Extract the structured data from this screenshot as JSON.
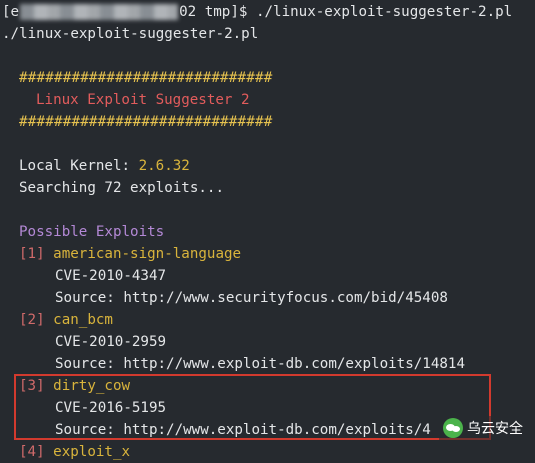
{
  "terminal": {
    "prompt_prefix": "[e",
    "prompt_suffix": "02 tmp]$ ./linux-exploit-suggester-2.pl",
    "echo_command": "./linux-exploit-suggester-2.pl",
    "banner_hash": "#############################",
    "banner_title": "Linux Exploit Suggester 2",
    "kernel_label": "Local Kernel: ",
    "kernel_version": "2.6.32",
    "searching": "Searching 72 exploits...",
    "possible_exploits": "Possible Exploits",
    "exploits": [
      {
        "num": "[1]",
        "name": "american-sign-language",
        "cve": "CVE-2010-4347",
        "source": "Source: http://www.securityfocus.com/bid/45408"
      },
      {
        "num": "[2]",
        "name": "can_bcm",
        "cve": "CVE-2010-2959",
        "source": "Source: http://www.exploit-db.com/exploits/14814"
      },
      {
        "num": "[3]",
        "name": "dirty_cow",
        "cve": "CVE-2016-5195",
        "source": "Source: http://www.exploit-db.com/exploits/4"
      },
      {
        "num": "[4]",
        "name": "exploit_x"
      }
    ]
  },
  "watermark": {
    "text": "乌云安全",
    "icon": "wechat-icon"
  },
  "colors": {
    "background": "#262a2f",
    "highlight_border": "#d23a2e",
    "yellow": "#d9b43c",
    "red": "#e25c5c",
    "purple": "#b489d6"
  }
}
